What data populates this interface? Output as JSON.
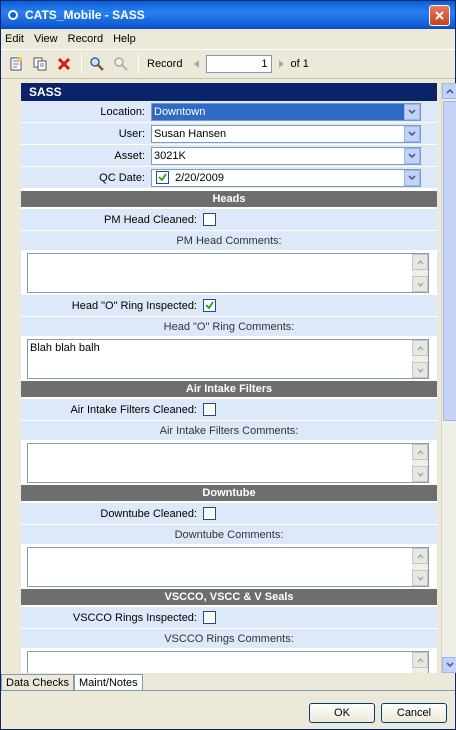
{
  "window": {
    "title": "CATS_Mobile - SASS"
  },
  "menu": {
    "items": [
      "Edit",
      "View",
      "Record",
      "Help"
    ]
  },
  "toolbar": {
    "record_label": "Record",
    "record_value": "1",
    "of_label": "of 1"
  },
  "form": {
    "header": "SASS",
    "fields": {
      "location": {
        "label": "Location:",
        "value": "Downtown"
      },
      "user": {
        "label": "User:",
        "value": "Susan Hansen"
      },
      "asset": {
        "label": "Asset:",
        "value": "3021K"
      },
      "qc_date": {
        "label": "QC Date:",
        "value": "2/20/2009"
      }
    },
    "sections": [
      {
        "title": "Heads",
        "check_label": "PM Head Cleaned:",
        "checked": false,
        "comment_label": "PM Head Comments:",
        "comment": ""
      },
      {
        "title": "",
        "check_label": "Head \"O\" Ring Inspected:",
        "checked": true,
        "comment_label": "Head \"O\" Ring Comments:",
        "comment": "Blah blah balh"
      },
      {
        "title": "Air Intake Filters",
        "check_label": "Air Intake Filters Cleaned:",
        "checked": false,
        "comment_label": "Air Intake Filters Comments:",
        "comment": ""
      },
      {
        "title": "Downtube",
        "check_label": "Downtube Cleaned:",
        "checked": false,
        "comment_label": "Downtube Comments:",
        "comment": ""
      },
      {
        "title": "VSCCO, VSCC & V Seals",
        "check_label": "VSCCO Rings Inspected:",
        "checked": false,
        "comment_label": "VSCCO Rings Comments:",
        "comment": ""
      }
    ]
  },
  "tabs": [
    "Data Checks",
    "Maint/Notes"
  ],
  "buttons": {
    "ok": "OK",
    "cancel": "Cancel"
  },
  "colors": {
    "titlebar": "#0a5fd8",
    "header": "#0a246a",
    "section": "#6e6e6e",
    "row": "#dde9f8",
    "selection": "#316ac5"
  }
}
